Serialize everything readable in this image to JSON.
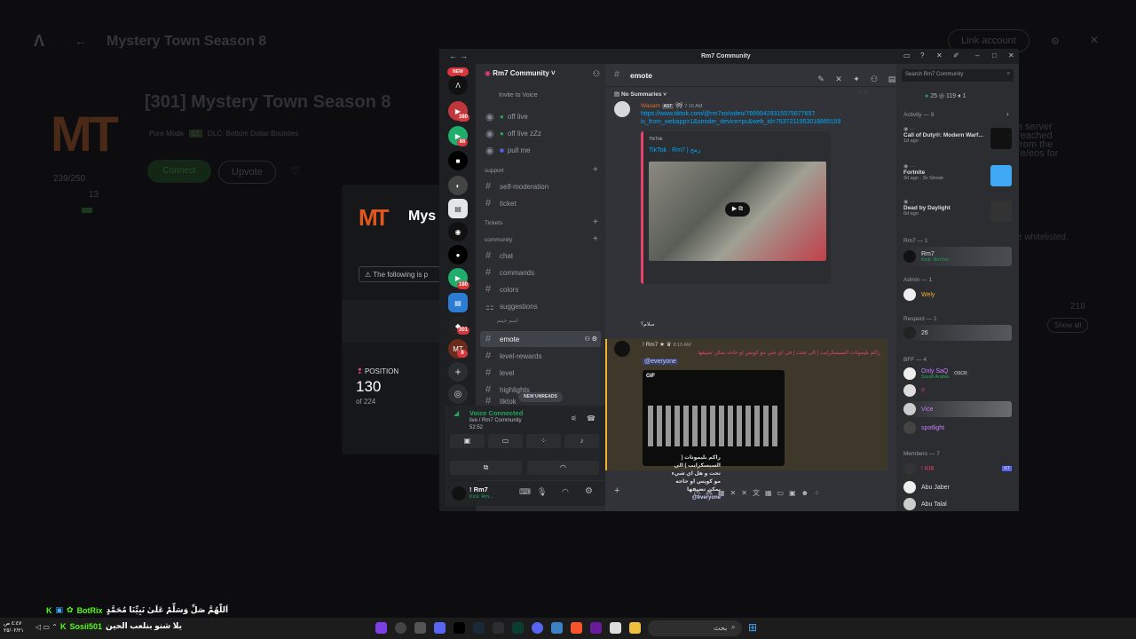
{
  "background": {
    "page_title": "Mystery Town Season 8",
    "link_account": "Link account",
    "server_title": "[301] Mystery Town Season 8",
    "logo": "MT",
    "tags": [
      "Pure Mode",
      "L1",
      "DLC: Bottom Dollar Bounties"
    ],
    "players": "239/250",
    "count13": "13",
    "connect": "Connect",
    "upvote": "Upvote",
    "modal_title": "Mys",
    "modal_warning": "The following is p",
    "position_label": "POSITION",
    "position_value": "130",
    "position_of": "of 224",
    "right_text_1": "e server",
    "right_text_2": "reached",
    "right_text_3": "from the",
    "right_text_4": "re/eos for",
    "whitelisted": "e whitelisted.",
    "num218": "218",
    "show_all": "Show all"
  },
  "discord": {
    "window_title": "Rm7 Community",
    "server_name": "Rm7 Community",
    "new_badge": "NEW",
    "guild_badges": [
      "380",
      "86",
      "180",
      "301",
      "8"
    ],
    "invite_to_voice": "Invite to Voice",
    "channels_top": [
      {
        "name": "off live"
      },
      {
        "name": "off live zZz"
      },
      {
        "name": "pull me"
      }
    ],
    "cat_support": "support",
    "support_channels": [
      "self-moderation",
      "ticket"
    ],
    "cat_tickets": "Tickets",
    "cat_community": "community",
    "community_channels": [
      "chat",
      "commands",
      "colors",
      "suggestions"
    ],
    "thread_label": "اسم جيتم",
    "active_channel": "emote",
    "more_channels": [
      "level-rewards",
      "level",
      "highlights",
      "tiktok"
    ],
    "new_unreads": "NEW UNREADS",
    "voice_connected": "Voice Connected",
    "voice_channel": "live / Rm7 Community",
    "voice_time": "52:52",
    "user_name": "! Rm7",
    "user_status": "Kick: Rm...",
    "chat_channel": "emote",
    "no_summaries": "No Summaries",
    "msg1_author": "Wasam",
    "msg1_tag": "AST",
    "msg1_time": "7:16 AM",
    "msg1_link_1": "https://www.tiktok.com/@rm7xo/video/7669942931557567765?",
    "msg1_link_2": "is_from_webapp=1&sender_device=pc&web_id=7637211953018865159",
    "embed_provider": "TikTok",
    "embed_title": "TikTok · Rm7 | رمح",
    "msg1_text": "سلام؟",
    "msg2_author": "! Rm7",
    "msg2_time": "8:19 AM",
    "msg2_text": "راكم بليموتات السيسكرايب ( الي تحت ) في اي شي مو كويس او حاجه يمكن تضيفها",
    "msg2_mention": "@everyone",
    "gif_label": "GIF",
    "composer_lines": [
      "راكم بليموتات (",
      "السيسكرايب ) الي",
      "تحت و هل اي شيء",
      "مو كويس او حاجه",
      "يمكن تضيفها"
    ],
    "composer_mention": "@everyone",
    "search_placeholder": "Search Rm7 Community",
    "stats": {
      "online": "25",
      "members": "119",
      "boost": "1"
    },
    "activity_header": "Activity — 9",
    "activities": [
      {
        "game": "Call of Duty®: Modern Warf...",
        "meta": "1d ago"
      },
      {
        "game": "Fortnite",
        "meta": "3d ago · 3x Streak"
      },
      {
        "game": "Dead by Daylight",
        "meta": "6d ago"
      }
    ],
    "role_rm7": "Rm7 — 1",
    "rm7_member": "Rm7",
    "rm7_sub": "Kick: Rm7xo",
    "role_admin": "Admin — 1",
    "admin_member": "Wely",
    "role_respect": "Respect — 1",
    "respect_member": "26",
    "role_bff": "BFF — 4",
    "bff_members": [
      "Only SaQ",
      "!!",
      "Vice",
      "spotlight"
    ],
    "bff_sub": "Saudi Arabia",
    "oscr": "OSCR",
    "role_members": "Members — 7",
    "members_list": [
      "! KI6",
      "Abu Jaber",
      "Abu Talal"
    ],
    "rt": "RT"
  },
  "overlay": {
    "chat_line1": "اَللّٰهُمَّ صَلِّ وَسَلِّمْ عَلَىٰ نَبِيِّنَا مُحَمَّدٍ",
    "bot_name": "BotRix",
    "chat_line2_user": "Sosii501",
    "chat_line2_text": "يلا شنو بنلعب الحين",
    "clock_time": "٤:٤٧ ص",
    "clock_date": "٢٥/٠٢/٢١",
    "search": "بحث"
  },
  "colors": {
    "discord_bg": "#313338",
    "blurple": "#5865f2",
    "red": "#da373c",
    "green": "#23a559",
    "link": "#00a8fc"
  }
}
